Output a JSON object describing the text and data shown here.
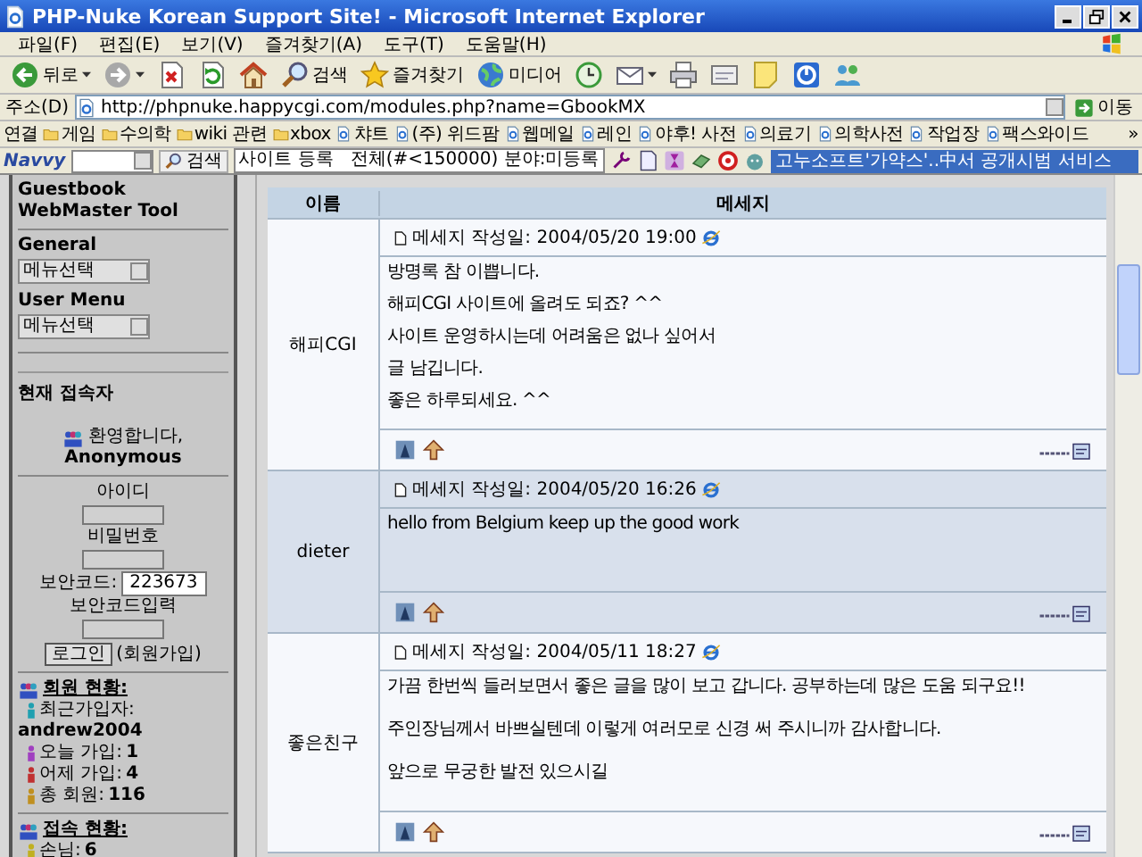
{
  "window": {
    "title": "PHP-Nuke Korean Support Site! - Microsoft Internet Explorer"
  },
  "menu": [
    "파일(F)",
    "편집(E)",
    "보기(V)",
    "즐겨찾기(A)",
    "도구(T)",
    "도움말(H)"
  ],
  "toolbar": [
    {
      "kind": "back",
      "label": "뒤로",
      "menu": true
    },
    {
      "kind": "forward",
      "menu": true
    },
    {
      "kind": "stop",
      "menu": false
    },
    {
      "kind": "refresh",
      "menu": false
    },
    {
      "kind": "home",
      "menu": false
    },
    {
      "kind": "search",
      "label": "검색",
      "menu": false
    },
    {
      "kind": "favorites",
      "label": "즐겨찾기",
      "menu": false
    },
    {
      "kind": "media",
      "label": "미디어",
      "menu": false
    },
    {
      "kind": "history",
      "menu": false
    },
    {
      "kind": "mail",
      "menu": true
    },
    {
      "kind": "print",
      "menu": false
    },
    {
      "kind": "edit",
      "menu": false
    },
    {
      "kind": "note",
      "menu": false
    },
    {
      "kind": "messenger",
      "menu": false
    },
    {
      "kind": "people",
      "menu": false
    }
  ],
  "address": {
    "label": "주소(D)",
    "url": "http://phpnuke.happycgi.com/modules.php?name=GbookMX",
    "go": "이동"
  },
  "links": {
    "label": "연결",
    "more": "»",
    "items": [
      {
        "kind": "folder",
        "label": "게임"
      },
      {
        "kind": "folder",
        "label": "수의학"
      },
      {
        "kind": "folder",
        "label": "wiki 관련"
      },
      {
        "kind": "folder",
        "label": "xbox"
      },
      {
        "kind": "page",
        "label": "챠트"
      },
      {
        "kind": "page",
        "label": "(주) 위드팜"
      },
      {
        "kind": "page",
        "label": "웹메일"
      },
      {
        "kind": "page",
        "label": "레인"
      },
      {
        "kind": "page",
        "label": "야후! 사전"
      },
      {
        "kind": "page",
        "label": "의료기"
      },
      {
        "kind": "page",
        "label": "의학사전"
      },
      {
        "kind": "page",
        "label": "작업장"
      },
      {
        "kind": "page",
        "label": "팩스와이드"
      }
    ]
  },
  "navvy": {
    "brand": "Navvy",
    "search": "검색",
    "field": "사이트 등록   전체(#<150000) 분야:미등록",
    "news": "고누소프트'가약스'..中서 공개시범 서비스"
  },
  "sidebar": {
    "top_items": [
      "Guestbook",
      "WebMaster Tool"
    ],
    "menus": [
      {
        "title": "General",
        "value": "메뉴선택"
      },
      {
        "title": "User Menu",
        "value": "메뉴선택"
      }
    ],
    "online": {
      "title": "현재 접속자",
      "welcome": "환영합니다,",
      "user": "Anonymous",
      "id_label": "아이디",
      "pw_label": "비밀번호",
      "code_label": "보안코드:",
      "code": "223673",
      "code_input_label": "보안코드입력",
      "login": "로그인",
      "join": "(회원가입)"
    },
    "members": {
      "title": "회원 현황:",
      "recent": {
        "label": "최근가입자:",
        "color": "#20a0b0"
      },
      "recent_user": "andrew2004",
      "items": [
        {
          "label": "오늘 가입:",
          "value": "1",
          "color": "#a040c0"
        },
        {
          "label": "어제 가입:",
          "value": "4",
          "color": "#c03030"
        },
        {
          "label": "총 회원:",
          "value": "116",
          "color": "#c09020"
        }
      ]
    },
    "visitors": {
      "title": "접속 현황:",
      "items": [
        {
          "label": "손님:",
          "value": "6",
          "color": "#c0b020"
        }
      ]
    }
  },
  "table": {
    "columns": [
      "이름",
      "메세지"
    ],
    "rows": [
      {
        "name": "해피CGI",
        "posted": "메세지 작성일: 2004/05/20 19:00",
        "lines": [
          "방명록 참 이쁩니다.",
          "해피CGI 사이트에 올려도 되죠? ^^",
          "사이트 운영하시는데 어려움은 없나 싶어서",
          "글 남깁니다.",
          "좋은 하루되세요. ^^"
        ]
      },
      {
        "name": "dieter",
        "posted": "메세지 작성일: 2004/05/20 16:26",
        "lines": [
          "hello from Belgium keep up the good work"
        ]
      },
      {
        "name": "좋은친구",
        "posted": "메세지 작성일: 2004/05/11 18:27",
        "lines": [
          "가끔 한번씩 들러보면서 좋은 글을 많이 보고 갑니다. 공부하는데 많은 도움 되구요!!",
          "주인장님께서 바쁘실텐데 이렇게 여러모로 신경 써 주시니까 감사합니다.",
          "앞으로 무궁한 발전 있으시길"
        ]
      }
    ]
  }
}
